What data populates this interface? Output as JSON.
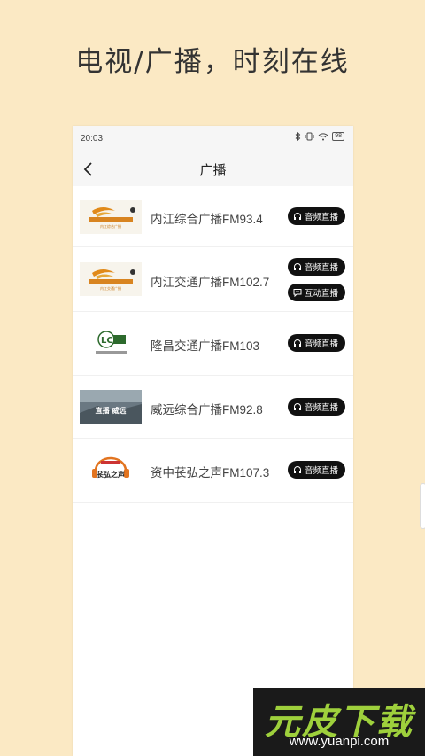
{
  "promo": {
    "title": "电视/广播，时刻在线"
  },
  "status": {
    "time": "20:03",
    "battery": "98"
  },
  "nav": {
    "title": "广播"
  },
  "stations": [
    {
      "name": "内江综合广播FM93.4",
      "buttons": [
        {
          "label": "音频直播",
          "icon": "headphone-icon"
        }
      ]
    },
    {
      "name": "内江交通广播FM102.7",
      "buttons": [
        {
          "label": "音频直播",
          "icon": "headphone-icon"
        },
        {
          "label": "互动直播",
          "icon": "chat-icon"
        }
      ]
    },
    {
      "name": "隆昌交通广播FM103",
      "buttons": [
        {
          "label": "音频直播",
          "icon": "headphone-icon"
        }
      ]
    },
    {
      "name": "威远综合广播FM92.8",
      "buttons": [
        {
          "label": "音频直播",
          "icon": "headphone-icon"
        }
      ]
    },
    {
      "name": "资中苌弘之声FM107.3",
      "buttons": [
        {
          "label": "音频直播",
          "icon": "headphone-icon"
        }
      ]
    }
  ],
  "logos": {
    "logo1_text": "内江综合广播",
    "logo2_text": "内江交通广播",
    "logo3_text": "LC",
    "logo4_text": "直播 威远",
    "logo5_text": "苌弘之声"
  },
  "watermark": {
    "brand": "元皮下载",
    "url": "www.yuanpi.com"
  },
  "colors": {
    "background": "#fbe9c4",
    "pill": "#111111",
    "brand_green": "#9ed03c"
  }
}
